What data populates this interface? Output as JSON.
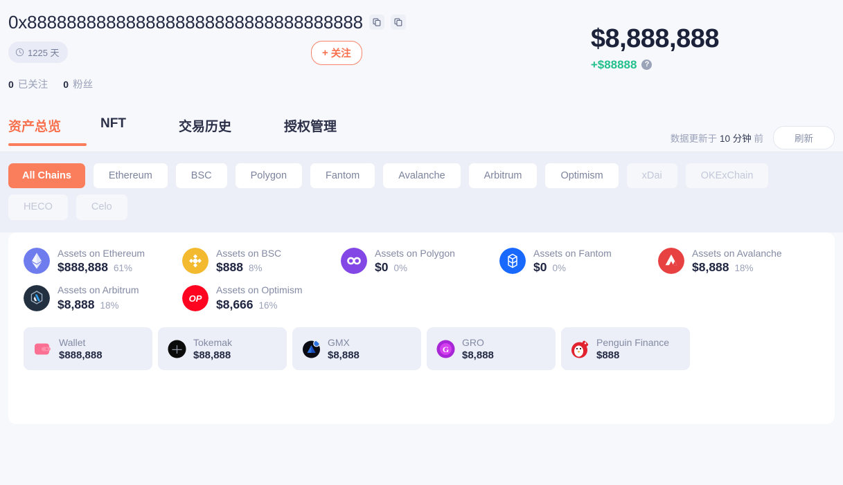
{
  "header": {
    "address": "0x8888888888888888888888888888888888",
    "copy_icon_1": "copy-icon",
    "copy_icon_2": "copy-icon",
    "days_badge": "1225 天",
    "clock_icon": "clock-icon",
    "follow_button": "关注",
    "follow_plus": "+",
    "following_count": "0",
    "following_label": "已关注",
    "fans_count": "0",
    "fans_label": "粉丝",
    "balance_total": "$8,888,888",
    "balance_change": "+$88888",
    "help_icon": "?",
    "accent_color": "#fa7e5c",
    "positive_color": "#23c08b"
  },
  "tabs": [
    {
      "label": "资产总览",
      "active": true
    },
    {
      "label": "NFT",
      "active": false
    },
    {
      "label": "交易历史",
      "active": false
    },
    {
      "label": "授权管理",
      "active": false
    }
  ],
  "tab_right": {
    "update_prefix": "数据更新于",
    "update_value": "10 分钟",
    "update_suffix": "前",
    "refresh_label": "刷新"
  },
  "chains": [
    {
      "label": "All Chains",
      "state": "active"
    },
    {
      "label": "Ethereum",
      "state": "normal"
    },
    {
      "label": "BSC",
      "state": "normal"
    },
    {
      "label": "Polygon",
      "state": "normal"
    },
    {
      "label": "Fantom",
      "state": "normal"
    },
    {
      "label": "Avalanche",
      "state": "normal"
    },
    {
      "label": "Arbitrum",
      "state": "normal"
    },
    {
      "label": "Optimism",
      "state": "normal"
    },
    {
      "label": "xDai",
      "state": "disabled"
    },
    {
      "label": "OKExChain",
      "state": "disabled"
    },
    {
      "label": "HECO",
      "state": "disabled"
    },
    {
      "label": "Celo",
      "state": "disabled"
    }
  ],
  "assets": [
    {
      "name": "Assets on Ethereum",
      "amount": "$888,888",
      "pct": "61%",
      "icon": "ethereum-icon",
      "color": "#6f7ced"
    },
    {
      "name": "Assets on BSC",
      "amount": "$888",
      "pct": "8%",
      "icon": "bsc-icon",
      "color": "#f3ba2f"
    },
    {
      "name": "Assets on Polygon",
      "amount": "$0",
      "pct": "0%",
      "icon": "polygon-icon",
      "color": "#8247e5"
    },
    {
      "name": "Assets on Fantom",
      "amount": "$0",
      "pct": "0%",
      "icon": "fantom-icon",
      "color": "#1969ff"
    },
    {
      "name": "Assets on Avalanche",
      "amount": "$8,888",
      "pct": "18%",
      "icon": "avalanche-icon",
      "color": "#e84142"
    },
    {
      "name": "Assets on Arbitrum",
      "amount": "$8,888",
      "pct": "18%",
      "icon": "arbitrum-icon",
      "color": "#2d374b"
    },
    {
      "name": "Assets on Optimism",
      "amount": "$8,666",
      "pct": "16%",
      "icon": "optimism-icon",
      "color": "#ff0420"
    }
  ],
  "protocols": [
    {
      "name": "Wallet",
      "amount": "$888,888",
      "icon": "wallet-icon",
      "color": "#fb6f92"
    },
    {
      "name": "Tokemak",
      "amount": "$88,888",
      "icon": "tokemak-icon",
      "color": "#0b0b0b"
    },
    {
      "name": "GMX",
      "amount": "$8,888",
      "icon": "gmx-icon",
      "color": "#0b0b14"
    },
    {
      "name": "GRO",
      "amount": "$8,888",
      "icon": "gro-icon",
      "color": "#a726d6"
    },
    {
      "name": "Penguin Finance",
      "amount": "$888",
      "icon": "penguin-finance-icon",
      "color": "#e0232e"
    }
  ]
}
